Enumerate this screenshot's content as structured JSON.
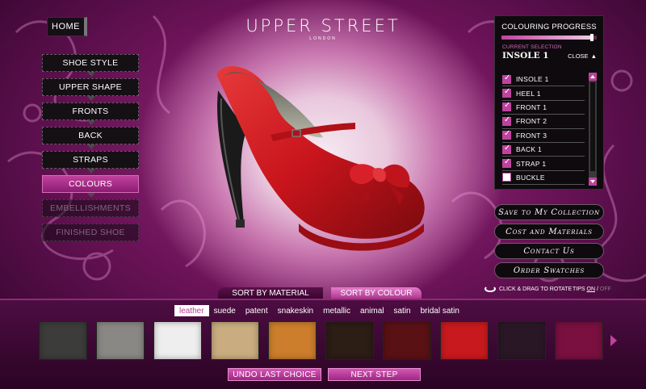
{
  "header": {
    "home_label": "HOME",
    "logo_main": "UPPER STREET",
    "logo_sub": "LONDON"
  },
  "nav": {
    "items": [
      {
        "label": "SHOE STYLE",
        "state": "normal"
      },
      {
        "label": "UPPER SHAPE",
        "state": "normal"
      },
      {
        "label": "FRONTS",
        "state": "normal"
      },
      {
        "label": "BACK",
        "state": "normal"
      },
      {
        "label": "STRAPS",
        "state": "normal"
      },
      {
        "label": "COLOURS",
        "state": "selected"
      },
      {
        "label": "EMBELLISHMENTS",
        "state": "disabled"
      },
      {
        "label": "FINISHED SHOE",
        "state": "disabled"
      }
    ]
  },
  "progress_panel": {
    "title": "COLOURING PROGRESS",
    "progress_fraction": 0.95,
    "current_selection_label": "CURRENT SELECTION",
    "current_selection_value": "INSOLE 1",
    "close_label": "CLOSE",
    "parts": [
      {
        "label": "INSOLE 1",
        "checked": true
      },
      {
        "label": "HEEL 1",
        "checked": true
      },
      {
        "label": "FRONT 1",
        "checked": true
      },
      {
        "label": "FRONT 2",
        "checked": true
      },
      {
        "label": "FRONT 3",
        "checked": true
      },
      {
        "label": "BACK 1",
        "checked": true
      },
      {
        "label": "STRAP 1",
        "checked": true
      },
      {
        "label": "BUCKLE",
        "checked": false
      }
    ]
  },
  "actions": {
    "save_collection": "Save to My Collection",
    "cost_materials": "Cost and Materials",
    "contact_us": "Contact Us",
    "order_swatches": "Order Swatches"
  },
  "viewer": {
    "rotate_hint": "CLICK & DRAG TO ROTATE",
    "tips_label": "TIPS",
    "tips_on": "ON",
    "tips_sep": "/",
    "tips_off": "OFF",
    "shoe_color": "#c8141c"
  },
  "sort": {
    "by_material": "SORT BY MATERIAL",
    "by_colour": "SORT BY COLOUR"
  },
  "materials": {
    "selected": "leather",
    "items": [
      "leather",
      "suede",
      "patent",
      "snakeskin",
      "metallic",
      "animal",
      "satin",
      "bridal satin"
    ]
  },
  "swatches": [
    "#3c3d3a",
    "#8a8884",
    "#eeeeee",
    "#c9ad80",
    "#cc7e2c",
    "#2c1d15",
    "#5a1114",
    "#c81a1e",
    "#2a1726",
    "#7a1040"
  ],
  "bottom_buttons": {
    "undo": "UNDO LAST CHOICE",
    "next": "NEXT STEP"
  },
  "colors": {
    "accent": "#c0429d",
    "background": "#6b1358"
  }
}
